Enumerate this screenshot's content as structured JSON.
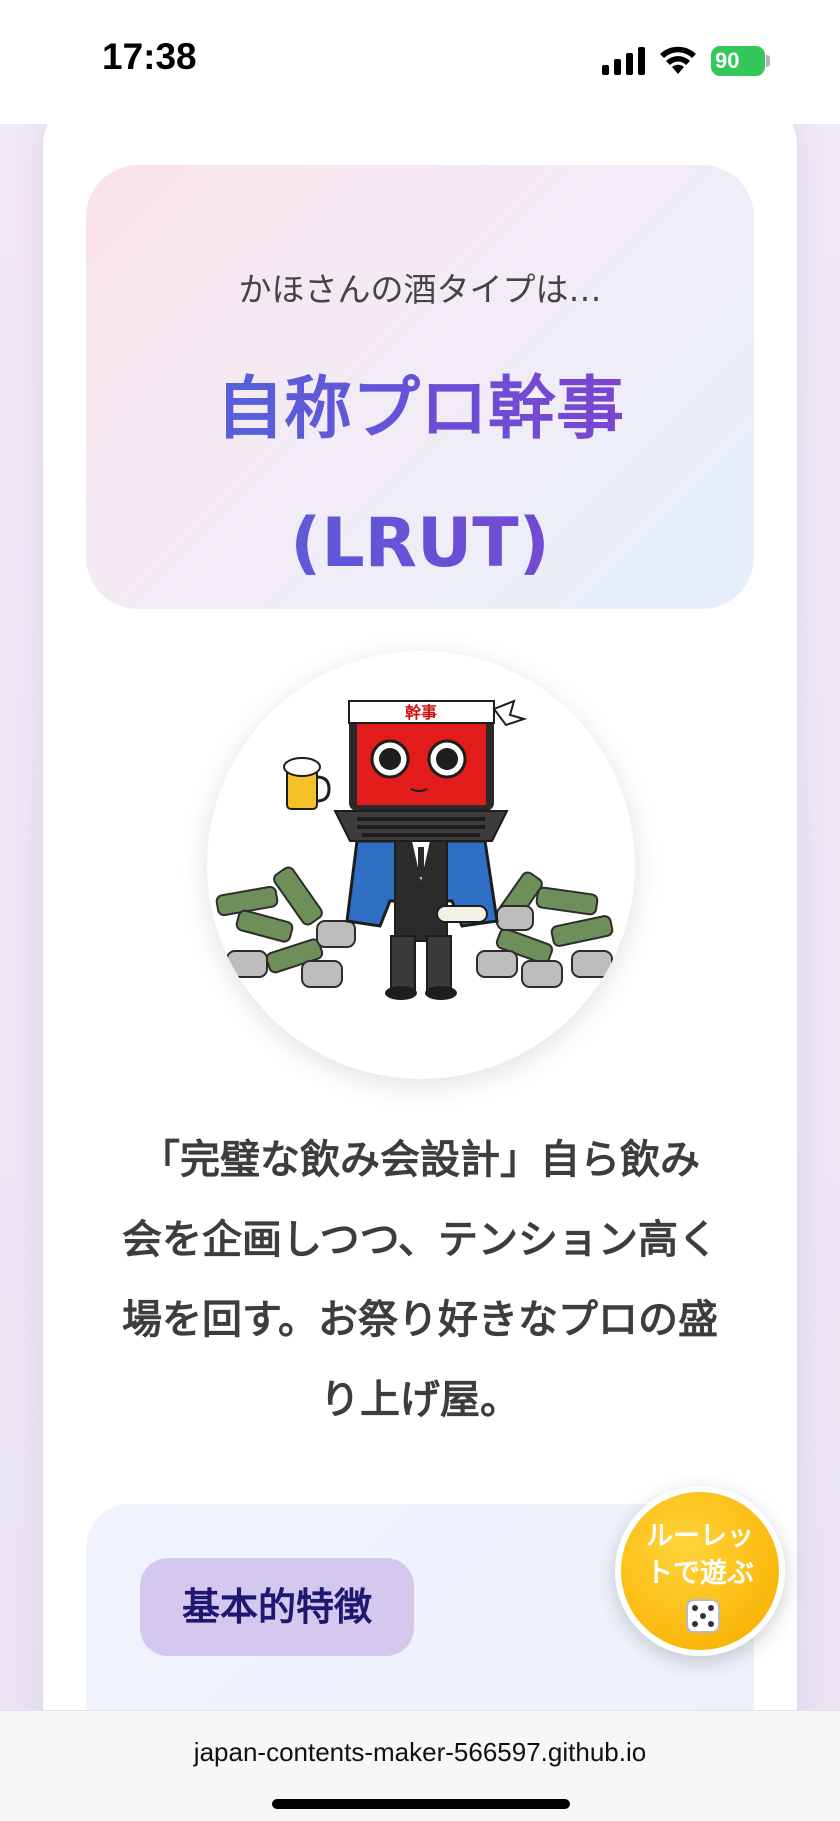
{
  "status_bar": {
    "time": "17:38",
    "battery_level": "90",
    "icons": [
      "signal-icon",
      "wifi-icon",
      "battery-icon"
    ]
  },
  "hero": {
    "intro": "かほさんの酒タイプは…",
    "title_line1": "自称プロ幹事",
    "title_line2": "(LRUT)",
    "gradient_colors": [
      "#4a6bdc",
      "#6a4fd6",
      "#8a3cc9"
    ]
  },
  "character_image": {
    "headband_text": "幹事",
    "icon": "laptop-mascot-illustration"
  },
  "description": {
    "lines": [
      "「完璧な飲み会設計」自ら飲み",
      "会を企画しつつ、テンション高く",
      "場を回す。お祭り好きなプロの盛",
      "り上げ屋。"
    ]
  },
  "features": {
    "tag_label": "基本的特徴"
  },
  "fab": {
    "label_line1": "ルーレッ",
    "label_line2": "トで遊ぶ",
    "icon": "dice-icon",
    "color": "#fbb80c"
  },
  "url_bar": {
    "url": "japan-contents-maker-566597.github.io"
  }
}
